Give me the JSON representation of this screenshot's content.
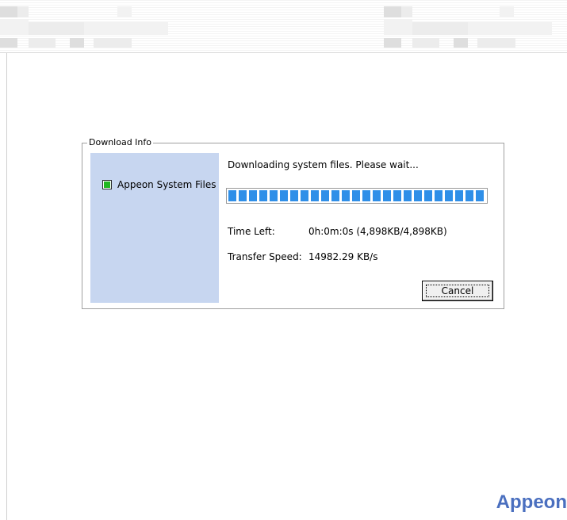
{
  "group": {
    "title": "Download Info"
  },
  "components": [
    {
      "label": "Appeon System Files",
      "icon": "green-square-check-icon",
      "checked": true
    }
  ],
  "status": {
    "message": "Downloading system files. Please wait..."
  },
  "progress": {
    "percent": 100
  },
  "stats": {
    "time_left_label": "Time Left:",
    "time_left_value": "0h:0m:0s (4,898KB/4,898KB)",
    "speed_label": "Transfer Speed:",
    "speed_value": "14982.29 KB/s"
  },
  "buttons": {
    "cancel": "Cancel"
  },
  "branding": {
    "name": "Appeon"
  },
  "colors": {
    "side_panel": "#c7d6f0",
    "progress": "#2f8fe8",
    "check": "#22b822",
    "brand": "#4a6fbf"
  }
}
